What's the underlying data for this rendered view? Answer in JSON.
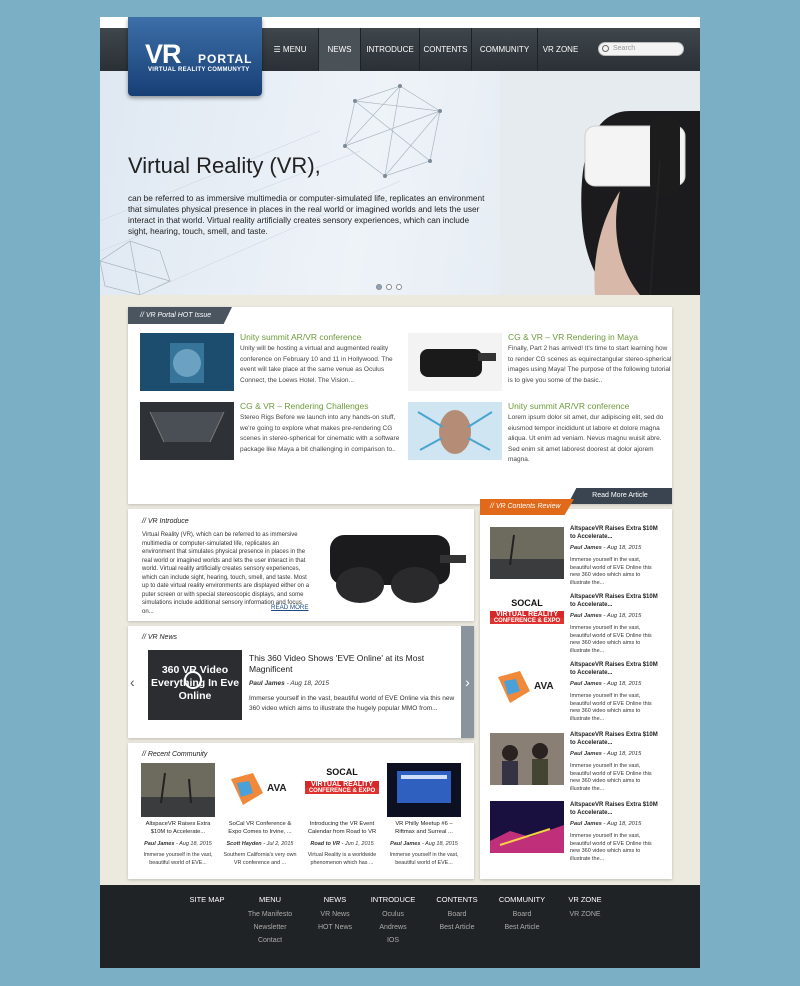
{
  "logo": {
    "big": "VR",
    "small": "PORTAL",
    "sub": "VIRTUAL REALITY COMMUNYTY"
  },
  "nav": {
    "items": [
      "MENU",
      "NEWS",
      "INTRODUCE",
      "CONTENTS",
      "COMMUNITY",
      "VR ZONE"
    ],
    "active": "NEWS",
    "search_placeholder": "Search"
  },
  "hero": {
    "title": "Virtual Reality (VR),",
    "desc": "can be referred to as immersive multimedia or computer-simulated life, replicates an environment that simulates physical presence in places in the real world or imagined worlds and lets the user interact in that world. Virtual reality artificially creates sensory experiences, which can include sight, hearing, touch, smell, and taste."
  },
  "hot": {
    "tab": "// VR Portal HOT Issue",
    "read_more": "Read More Article",
    "items": [
      {
        "title": "Unity summit AR/VR conference",
        "text": "Unity will be hosting a virtual and augmented reality conference on February 10 and 11 in Hollywood. The event will take place at the same venue as Oculus Connect, the Loews Hotel. The Vision..."
      },
      {
        "title": "CG & VR – VR Rendering in Maya",
        "text": "Finally, Part 2 has arrived! It's time to start learning how to render CG scenes as equirectangular stereo-spherical images using Maya! The purpose of the following tutorial is to give you some of the basic.."
      },
      {
        "title": "CG & VR – Rendering Challenges",
        "text": "Stereo Rigs Before we launch into any hands-on stuff, we're going to explore what makes pre-rendering CG scenes in stereo-spherical for cinematic with a software package like Maya a bit challenging in comparison to.."
      },
      {
        "title": "Unity summit AR/VR conference",
        "text": "Lorem ipsum dolor sit amet, dur adipiscing elit, sed do eiusmod tempor incididunt ut labore et dolore magna aliqua. Ut enim ad veniam. Nevus magnu wuisit abre. Sed enim sit amet laborest doorest at dolor ajorem magna."
      }
    ]
  },
  "intro": {
    "title": "// VR Introduce",
    "text": "Virtual Reality (VR), which can be referred to as immersive multimedia or computer-simulated life, replicates an environment that simulates physical presence in places in the real world or imagined worlds and lets the user interact in that world. Virtual reality artificially creates sensory experiences, which can include sight, hearing, touch, smell, and taste. Most up to date virtual reality environments are displayed either on a puter screen or with special stereoscopic displays, and some simulations include additional sensory information and focus on...",
    "read_more": "READ MORE"
  },
  "news": {
    "title": "// VR News",
    "thumb_text": "360 VR Video Everything In Eve Online",
    "headline": "This 360 Video Shows 'EVE Online' at its Most Magnificent",
    "author": "Paul James",
    "date": "Aug 18, 2015",
    "text": "Immerse yourself in the vast, beautiful world of EVE Online via this new 360 video which aims to illustrate the hugely popular MMO from..."
  },
  "community": {
    "title": "// Recent Community",
    "items": [
      {
        "title": "AltspaceVR Raises Extra $10M to Accelerate...",
        "author": "Paul James",
        "date": "Aug 18, 2015",
        "text": "Immerse yourself in the vast, beautiful world of EVE..."
      },
      {
        "title": "SoCal VR Conference & Expo Comes to Irvine, ...",
        "author": "Scott Hayden",
        "date": "Jul 2, 2015",
        "text": "Southern California's very own VR conference and ..."
      },
      {
        "title": "Introducing the VR Event Calendar from Road to VR",
        "author": "Road to VR",
        "date": "Jun 1, 2015",
        "text": "Virtual Reality is a worldwide phenomenon which has ..."
      },
      {
        "title": "VR Philly Meetup #6 – Riftmax and Surreal ...",
        "author": "Paul James",
        "date": "Aug 18, 2015",
        "text": "Immerse yourself in the vast, beautiful world of EVE..."
      }
    ]
  },
  "review": {
    "tab": "// VR Contents Review",
    "items": [
      {
        "title": "AltspaceVR Raises Extra $10M to Accelerate...",
        "author": "Paul James",
        "date": "Aug 18, 2015",
        "text": "Immerse yourself in the vast, beautiful world of EVE Online this new 360 video which aims to illustrate the..."
      },
      {
        "title": "AltspaceVR Raises Extra $10M to Accelerate...",
        "author": "Paul James",
        "date": "Aug 18, 2015",
        "text": "Immerse yourself in the vast, beautiful world of EVE Online this new 360 video which aims to illustrate the..."
      },
      {
        "title": "AltspaceVR Raises Extra $10M to Accelerate...",
        "author": "Paul James",
        "date": "Aug 18, 2015",
        "text": "Immerse yourself in the vast, beautiful world of EVE Online this new 360 video which aims to illustrate the..."
      },
      {
        "title": "AltspaceVR Raises Extra $10M to Accelerate...",
        "author": "Paul James",
        "date": "Aug 18, 2015",
        "text": "Immerse yourself in the vast, beautiful world of EVE Online this new 360 video which aims to illustrate the..."
      },
      {
        "title": "AltspaceVR Raises Extra $10M to Accelerate...",
        "author": "Paul James",
        "date": "Aug 18, 2015",
        "text": "Immerse yourself in the vast, beautiful world of EVE Online this new 360 video which aims to illustrate the..."
      }
    ]
  },
  "socal": {
    "line1": "SOCAL",
    "line2": "VIRTUAL REALITY",
    "line3": "CONFERENCE & EXPO"
  },
  "footer": {
    "columns": [
      {
        "head": "SITE MAP",
        "links": []
      },
      {
        "head": "MENU",
        "links": [
          "The Manifesto",
          "Newsletter",
          "Contact"
        ]
      },
      {
        "head": "NEWS",
        "links": [
          "VR News",
          "HOT News"
        ]
      },
      {
        "head": "INTRODUCE",
        "links": [
          "Oculus",
          "Andrews",
          "IOS"
        ]
      },
      {
        "head": "CONTENTS",
        "links": [
          "Board",
          "Best Article"
        ]
      },
      {
        "head": "COMMUNITY",
        "links": [
          "Board",
          "Best Article"
        ]
      },
      {
        "head": "VR ZONE",
        "links": [
          "VR ZONE"
        ]
      }
    ]
  },
  "colors": {
    "accent_green": "#6d9a3a",
    "review_orange": "#e06a1a",
    "logo_blue": "#1f4b85"
  }
}
